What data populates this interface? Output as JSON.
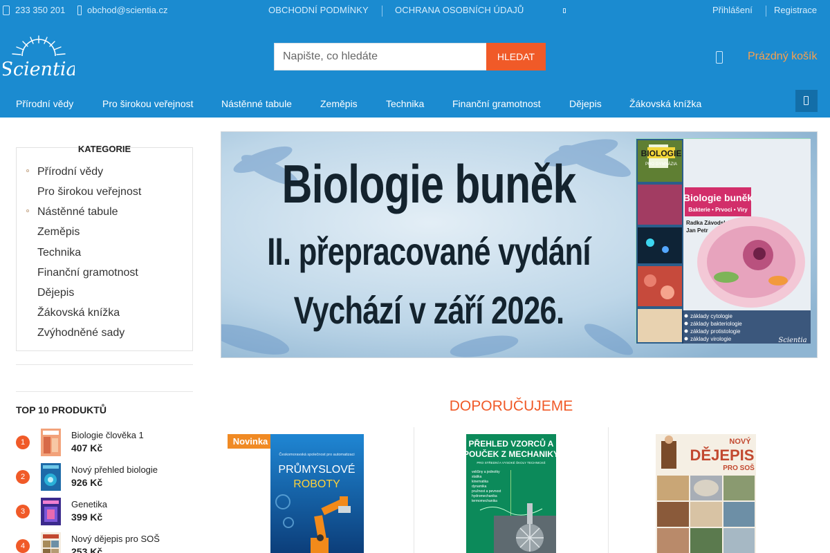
{
  "topbar": {
    "phone": "233 350 201",
    "email": "obchod@scientia.cz",
    "terms_link": "OBCHODNÍ PODMÍNKY",
    "privacy_link": "OCHRANA OSOBNÍCH ÚDAJŮ",
    "login_link": "Přihlášení",
    "register_link": "Registrace"
  },
  "brand": {
    "name": "Scientia"
  },
  "search": {
    "placeholder": "Napište, co hledáte",
    "button_label": "HLEDAT"
  },
  "cart": {
    "label": "Prázdný košík"
  },
  "nav": {
    "items": [
      "Přírodní vědy",
      "Pro širokou veřejnost",
      "Nástěnné tabule",
      "Zeměpis",
      "Technika",
      "Finanční gramotnost",
      "Dějepis",
      "Žákovská knížka"
    ]
  },
  "sidebar": {
    "categories_title": "KATEGORIE",
    "categories": [
      "Přírodní vědy",
      "Pro širokou veřejnost",
      "Nástěnné tabule",
      "Zeměpis",
      "Technika",
      "Finanční gramotnost",
      "Dějepis",
      "Žákovská knížka",
      "Zvýhodněné sady"
    ],
    "top10_title": "TOP 10 PRODUKTŮ",
    "top10": [
      {
        "rank": "1",
        "name": "Biologie člověka 1",
        "price": "407 Kč"
      },
      {
        "rank": "2",
        "name": "Nový přehled biologie",
        "price": "926 Kč"
      },
      {
        "rank": "3",
        "name": "Genetika",
        "price": "399 Kč"
      },
      {
        "rank": "4",
        "name": "Nový dějepis pro SOŠ",
        "price": "253 Kč"
      }
    ]
  },
  "banner": {
    "line1": "Biologie buněk",
    "line2": "II. přepracované vydání",
    "line3": "Vychází v září 2026.",
    "cover_series": "BIOLOGIE",
    "cover_series_sub": "PRO GYMNÁZIA",
    "cover_authors": "Radka Závodská\nJan Petr",
    "cover_title": "Biologie buněk",
    "cover_subtitle": "Bakterie • Prvoci • Viry",
    "cover_bullets": [
      "základy cytologie",
      "základy bakteriologie",
      "základy protistologie",
      "základy virologie"
    ],
    "cover_publisher": "Scientia"
  },
  "recommended": {
    "title": "DOPORUČUJEME",
    "badge": "Novinka",
    "products": [
      {
        "cover_top": "Českomoravská společnost pro automatizaci",
        "cover_title1": "PRŮMYSLOVÉ",
        "cover_title2": "ROBOTY"
      },
      {
        "cover_title1": "PŘEHLED VZORCŮ A",
        "cover_title2": "POUČEK Z MECHANIKY",
        "cover_sub": "PRO STŘEDNÍ A VYSOKÉ ŠKOLY TECHNICKÉ",
        "cover_lines": [
          "veličiny a jednotky",
          "statika",
          "kinematika",
          "dynamika",
          "pružnost a pevnost",
          "hydromechanika",
          "termomechanika"
        ]
      },
      {
        "cover_title1": "NOVÝ",
        "cover_title2": "DĚJEPIS",
        "cover_sub": "PRO SOŠ"
      }
    ]
  },
  "colors": {
    "header_blue": "#1b8bd0",
    "accent_orange": "#f05a28",
    "cart_orange": "#f9a04c",
    "badge_orange": "#f08a24"
  }
}
